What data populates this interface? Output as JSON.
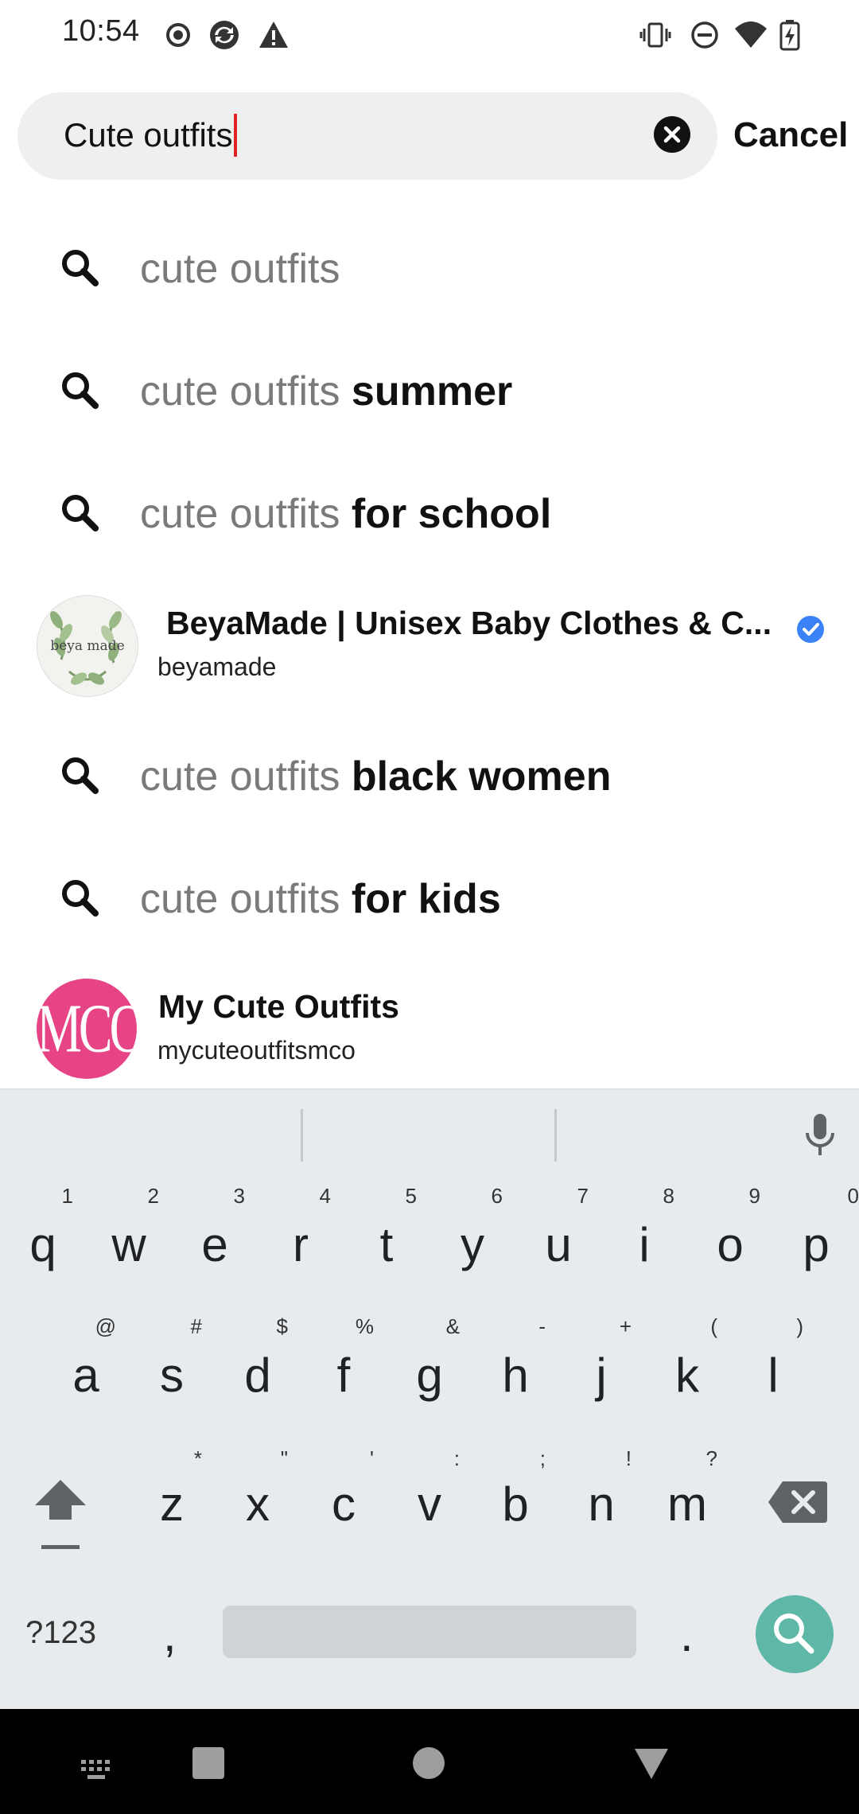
{
  "status_bar": {
    "time": "10:54",
    "left_icons": [
      "record-icon",
      "sync-icon",
      "alert-icon"
    ],
    "right_icons": [
      "vibrate-icon",
      "do-not-disturb-icon",
      "wifi-icon",
      "battery-charging-icon"
    ]
  },
  "search": {
    "query": "Cute outfits",
    "clear_icon": "close-circle-icon",
    "cancel_label": "Cancel"
  },
  "suggestions": [
    {
      "type": "query",
      "prefix": "cute outfits",
      "suffix": ""
    },
    {
      "type": "query",
      "prefix": "cute outfits",
      "suffix": "summer"
    },
    {
      "type": "query",
      "prefix": "cute outfits",
      "suffix": "for school"
    },
    {
      "type": "profile",
      "name": "BeyaMade  | Unisex Baby Clothes & C...",
      "handle": "beyamade",
      "verified": true,
      "avatar_text": "beya made"
    },
    {
      "type": "query",
      "prefix": "cute outfits",
      "suffix": "black women"
    },
    {
      "type": "query",
      "prefix": "cute outfits",
      "suffix": "for kids"
    },
    {
      "type": "profile",
      "name": "My Cute Outfits",
      "handle": "mycuteoutfitsmco",
      "verified": false,
      "avatar_text": "MCO"
    }
  ],
  "keyboard": {
    "row1": [
      {
        "char": "q",
        "hint": "1"
      },
      {
        "char": "w",
        "hint": "2"
      },
      {
        "char": "e",
        "hint": "3"
      },
      {
        "char": "r",
        "hint": "4"
      },
      {
        "char": "t",
        "hint": "5"
      },
      {
        "char": "y",
        "hint": "6"
      },
      {
        "char": "u",
        "hint": "7"
      },
      {
        "char": "i",
        "hint": "8"
      },
      {
        "char": "o",
        "hint": "9"
      },
      {
        "char": "p",
        "hint": "0"
      }
    ],
    "row2": [
      {
        "char": "a",
        "hint": "@"
      },
      {
        "char": "s",
        "hint": "#"
      },
      {
        "char": "d",
        "hint": "$"
      },
      {
        "char": "f",
        "hint": "%"
      },
      {
        "char": "g",
        "hint": "&"
      },
      {
        "char": "h",
        "hint": "-"
      },
      {
        "char": "j",
        "hint": "+"
      },
      {
        "char": "k",
        "hint": "("
      },
      {
        "char": "l",
        "hint": ")"
      }
    ],
    "row3": [
      {
        "char": "z",
        "hint": "*"
      },
      {
        "char": "x",
        "hint": "\""
      },
      {
        "char": "c",
        "hint": "'"
      },
      {
        "char": "v",
        "hint": ":"
      },
      {
        "char": "b",
        "hint": ";"
      },
      {
        "char": "n",
        "hint": "!"
      },
      {
        "char": "m",
        "hint": "?"
      }
    ],
    "symbols_label": "?123",
    "comma": ",",
    "period": "."
  },
  "colors": {
    "cursor": "#e02424",
    "verified": "#3b82f6",
    "mco_avatar": "#e74486",
    "search_key": "#5fb7a8"
  }
}
